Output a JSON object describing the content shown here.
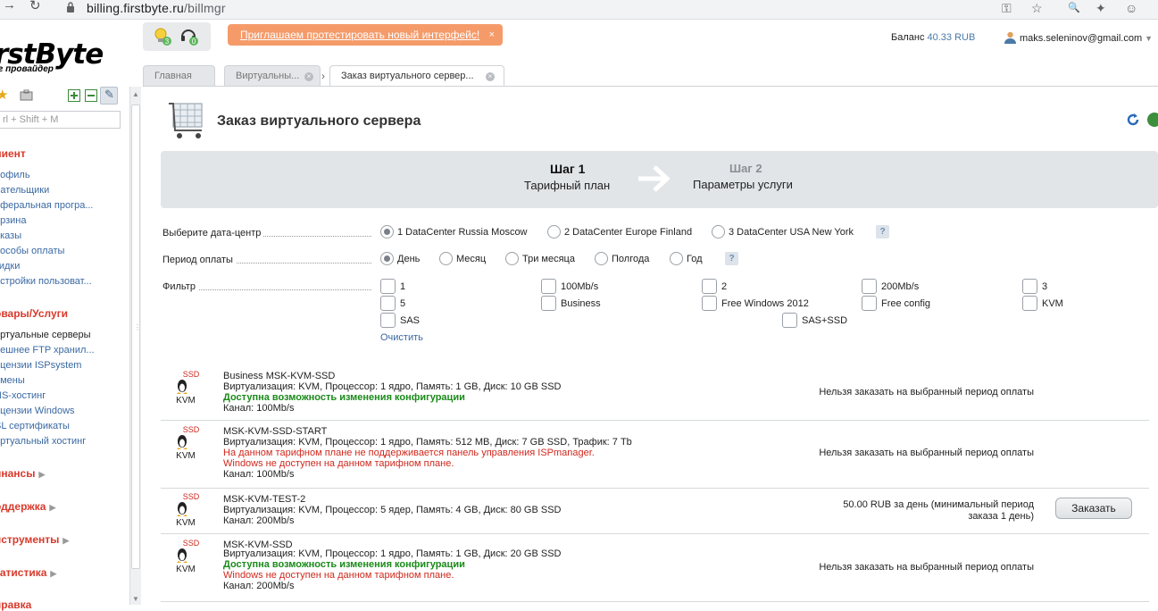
{
  "browser": {
    "url_host": "billing.firstbyte.ru",
    "url_path": "/billmgr"
  },
  "header": {
    "logo_text": "rstByte",
    "logo_sub": "г провайдер",
    "promo_text": "Приглашаем протестировать новый интерфейс!",
    "promo_close": "×",
    "balance_label": "Баланс",
    "balance_value": "40.33 RUB",
    "user_email": "maks.seleninov@gmail.com",
    "notif_count_1": "3",
    "notif_count_2": "0"
  },
  "tabs": [
    {
      "label": "Главная"
    },
    {
      "label": "Виртуальны..."
    },
    {
      "label": "Заказ виртуального сервер..."
    }
  ],
  "sidebar": {
    "search_placeholder": "rl + Shift + M",
    "section_client": "лиент",
    "client_items": [
      "рофиль",
      "лательщики",
      "еферальная програ...",
      "орзина",
      "аказы",
      "пособы оплаты",
      "кидки",
      "астройки пользоват..."
    ],
    "section_goods": "овары/Услуги",
    "goods_items": [
      "иртуальные серверы",
      "нешнее FTP хранил...",
      "ицензии ISPsystem",
      "омены",
      "NS-хостинг",
      "ицензии Windows",
      "SL сертификаты",
      "иртуальный хостинг"
    ],
    "section_finance": "инансы",
    "section_support": "оддержка",
    "section_tools": "нструменты",
    "section_stats": "татистика",
    "section_help": "правка"
  },
  "page": {
    "title": "Заказ виртуального сервера",
    "step1_title": "Шаг 1",
    "step1_sub": "Тарифный план",
    "step2_title": "Шаг 2",
    "step2_sub": "Параметры услуги",
    "dc_label": "Выберите дата-центр",
    "dc_options": [
      "1 DataCenter Russia Moscow",
      "2 DataCenter Europe Finland",
      "3 DataCenter USA New York"
    ],
    "period_label": "Период оплаты",
    "period_options": [
      "День",
      "Месяц",
      "Три месяца",
      "Полгода",
      "Год"
    ],
    "filter_label": "Фильтр",
    "filters": [
      "1",
      "100Mb/s",
      "2",
      "200Mb/s",
      "3",
      "5",
      "Business",
      "Free Windows 2012",
      "Free config",
      "KVM",
      "SAS",
      "SAS+SSD"
    ],
    "clear_label": "Очистить",
    "help": "?"
  },
  "plans": [
    {
      "name": "Business MSK-KVM-SSD",
      "desc": "Виртуализация: KVM, Процессор: 1 ядро, Память: 1 GB, Диск: 10 GB SSD",
      "ok": "Доступна возможность изменения конфигурации",
      "err1": "",
      "err2": "",
      "channel": "Канал: 100Mb/s",
      "status": "Нельзя заказать на выбранный период оплаты"
    },
    {
      "name": "MSK-KVM-SSD-START",
      "desc": "Виртуализация: KVM, Процессор: 1 ядро, Память: 512 MB, Диск: 7 GB SSD, Трафик: 7 Tb",
      "ok": "",
      "err1": "На данном тарифном плане не поддерживается панель управления ISPmanager.",
      "err2": "Windows не доступен на данном тарифном плане.",
      "channel": "Канал: 100Mb/s",
      "status": "Нельзя заказать на выбранный период оплаты"
    },
    {
      "name": "MSK-KVM-TEST-2",
      "desc": "Виртуализация: KVM, Процессор: 5 ядер, Память: 4 GB, Диск: 80 GB SSD",
      "channel": "Канал: 200Mb/s",
      "price_line1": "50.00 RUB за день (минимальный период",
      "price_line2": "заказа 1 день)",
      "order_label": "Заказать"
    },
    {
      "name": "MSK-KVM-SSD",
      "desc": "Виртуализация: KVM, Процессор: 1 ядро, Память: 1 GB, Диск: 20 GB SSD",
      "ok": "Доступна возможность изменения конфигурации",
      "err1": "Windows не доступен на данном тарифном плане.",
      "channel": "Канал: 200Mb/s",
      "status": "Нельзя заказать на выбранный период оплаты"
    }
  ],
  "plan_logo": {
    "top": "SSD",
    "bottom": "KVM"
  },
  "colors": {
    "promo": "#f59b6a",
    "accent_red": "#d83a2c",
    "link": "#3a69a3",
    "ok_green": "#1a8a1a",
    "error_red": "#d0281d"
  }
}
